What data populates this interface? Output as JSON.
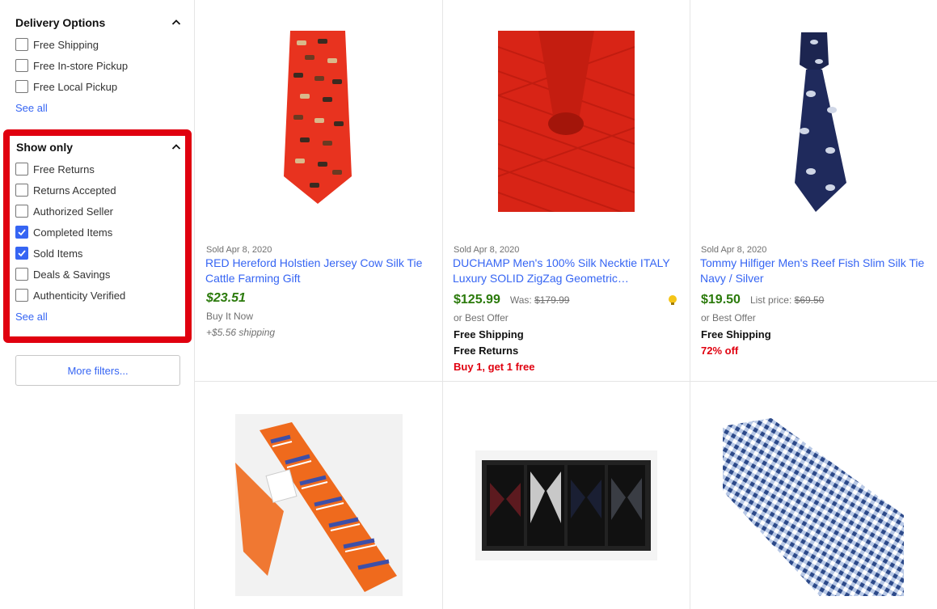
{
  "sidebar": {
    "delivery": {
      "title": "Delivery Options",
      "options": [
        {
          "label": "Free Shipping",
          "checked": false
        },
        {
          "label": "Free In-store Pickup",
          "checked": false
        },
        {
          "label": "Free Local Pickup",
          "checked": false
        }
      ],
      "see_all": "See all"
    },
    "show_only": {
      "title": "Show only",
      "options": [
        {
          "label": "Free Returns",
          "checked": false
        },
        {
          "label": "Returns Accepted",
          "checked": false
        },
        {
          "label": "Authorized Seller",
          "checked": false
        },
        {
          "label": "Completed Items",
          "checked": true
        },
        {
          "label": "Sold Items",
          "checked": true
        },
        {
          "label": "Deals & Savings",
          "checked": false
        },
        {
          "label": "Authenticity Verified",
          "checked": false
        }
      ],
      "see_all": "See all"
    },
    "more_filters": "More filters..."
  },
  "items": [
    {
      "sold": "Sold Apr 8, 2020",
      "title": "RED Hereford Holstien Jersey Cow Silk Tie Cattle Farming Gift",
      "price": "$23.51",
      "buy_it_now": "Buy It Now",
      "shipping": "+$5.56 shipping"
    },
    {
      "sold": "Sold Apr 8, 2020",
      "title": "DUCHAMP Men's 100% Silk Necktie ITALY Luxury SOLID ZigZag Geometric…",
      "price": "$125.99",
      "was_label": "Was:",
      "was_price": "$179.99",
      "best_offer": "or Best Offer",
      "free_shipping": "Free Shipping",
      "free_returns": "Free Returns",
      "promo": "Buy 1, get 1 free"
    },
    {
      "sold": "Sold Apr 8, 2020",
      "title": "Tommy Hilfiger Men's Reef Fish Slim Silk Tie Navy / Silver",
      "price": "$19.50",
      "list_label": "List price:",
      "list_price": "$69.50",
      "best_offer": "or Best Offer",
      "free_shipping": "Free Shipping",
      "discount": "72% off"
    }
  ],
  "colors": {
    "link": "#3665f3",
    "price": "#2b7a0b",
    "highlight": "#e0000f"
  }
}
